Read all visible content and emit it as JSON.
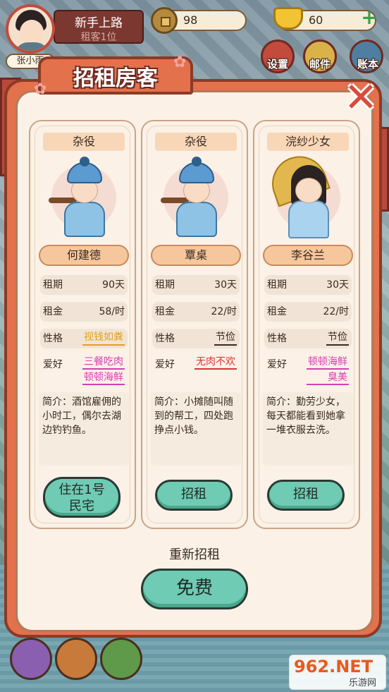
{
  "player": {
    "name": "张小雨",
    "level_title": "新手上路",
    "tenant_status": "租客1位",
    "coins": "98",
    "ingots": "60"
  },
  "menu": {
    "settings": "设置",
    "mail": "邮件",
    "ledger": "账本"
  },
  "dialog": {
    "title": "招租房客",
    "reroll_label": "重新招租",
    "free_button": "免费"
  },
  "labels": {
    "period": "租期",
    "rent": "租金",
    "personality": "性格",
    "hobby": "爱好"
  },
  "tenants": [
    {
      "role": "杂役",
      "name": "何建德",
      "period": "90天",
      "rent": "58/时",
      "personality": "视钱如粪",
      "personality_color": "#e0a11a",
      "hobbies": [
        "三餐吃肉",
        "顿顿海鲜"
      ],
      "hobby_color": "#d63fb0",
      "intro": "简介：酒馆雇佣的小时工，偶尔去湖边钓钓鱼。",
      "action": "住在1号民宅"
    },
    {
      "role": "杂役",
      "name": "覃桌",
      "period": "30天",
      "rent": "22/时",
      "personality": "节俭",
      "personality_color": "#3a2a20",
      "hobbies": [
        "无肉不欢"
      ],
      "hobby_color": "#e0303a",
      "intro": "简介：小摊随叫随到的帮工，四处跑挣点小钱。",
      "action": "招租"
    },
    {
      "role": "浣纱少女",
      "name": "李谷兰",
      "period": "30天",
      "rent": "22/时",
      "personality": "节俭",
      "personality_color": "#3a2a20",
      "hobbies": [
        "顿顿海鲜",
        "臭美"
      ],
      "hobby_color": "#d63fb0",
      "intro": "简介：勤劳少女，每天都能看到她拿一堆衣服去洗。",
      "action": "招租"
    }
  ],
  "watermark": {
    "brand": "962.NET",
    "sub": "乐游网"
  }
}
